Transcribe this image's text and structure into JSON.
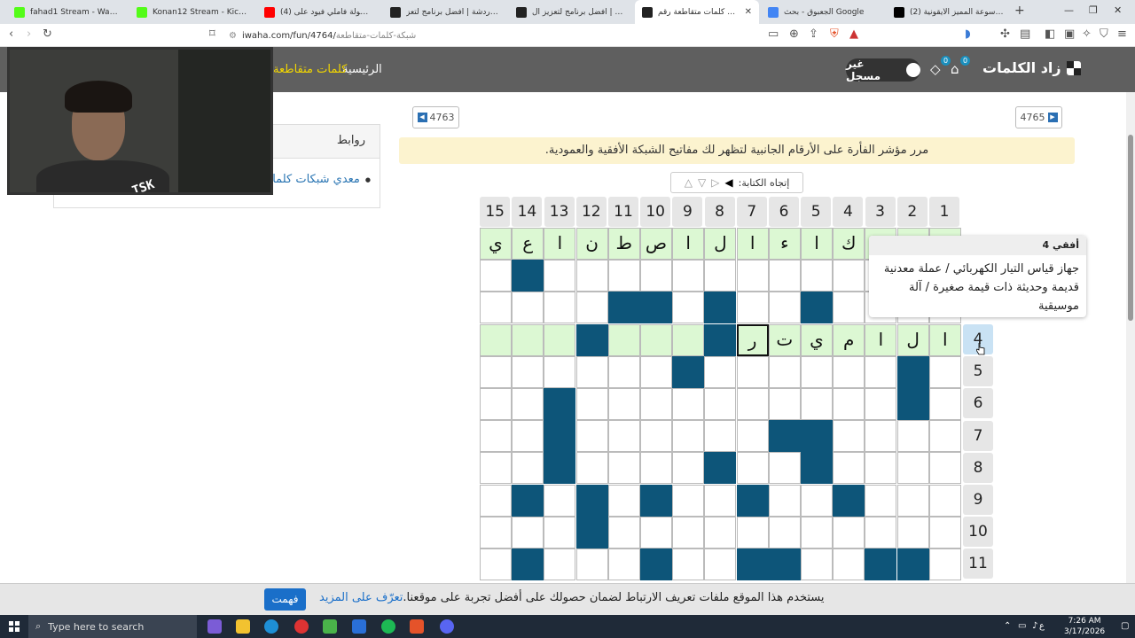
{
  "browser": {
    "tabs": [
      {
        "title": "fahad1 Stream - Watch Live on",
        "color": "#53fc18",
        "active": false
      },
      {
        "title": "Konan12 Stream - Kick Dashbo",
        "color": "#53fc18",
        "active": false
      },
      {
        "title": "(4) نهائي بطولة فاملي فيود على",
        "color": "#ff0000",
        "active": false
      },
      {
        "title": "بوت الدردشة | أفضل برنامج لتعز",
        "color": "#222222",
        "active": false
      },
      {
        "title": "التنبيهات | أفضل برنامج لتعزيز ال",
        "color": "#222222",
        "active": false
      },
      {
        "title": "شبكة كلمات متقاطعة رقم",
        "color": "#222222",
        "active": true
      },
      {
        "title": "الجعبوق - بحث Google",
        "color": "#4285f4",
        "active": false
      },
      {
        "title": "(2) موسوعة المميز الأيقونية +X",
        "color": "#000000",
        "active": false
      }
    ],
    "url_host": "iwaha.com/fun/4764/",
    "url_path": "شبكة-كلمات-متقاطعة"
  },
  "site": {
    "logo": "زاد الكلمات",
    "user_label": "غير مسجل",
    "badge_cart": "0",
    "badge_diamond": "0",
    "nav_home": "الرئيسية",
    "nav_crosswords": "كلمات متقاطعة"
  },
  "sidebar": {
    "heading": "روابط",
    "link": "معدي شبكات كلمات متقاطعة"
  },
  "main": {
    "prev_puzzle": "4763",
    "next_puzzle": "4765",
    "info": "مرر مؤشر الفأرة على الأرقام الجانبية لتظهر لك مفاتيح الشبكة الأفقية والعمودية.",
    "direction_label": "إتجاه الكتابة:"
  },
  "grid": {
    "col_numbers": [
      "1",
      "2",
      "3",
      "4",
      "5",
      "6",
      "7",
      "8",
      "9",
      "10",
      "11",
      "12",
      "13",
      "14",
      "15"
    ],
    "row_numbers": [
      "4",
      "5",
      "6",
      "7",
      "8",
      "9",
      "10",
      "11"
    ],
    "rows": [
      [
        "ي",
        "ع",
        "ا",
        "ن",
        "ط",
        "ص",
        "ا",
        "ل",
        "ا",
        "ء",
        "ا",
        "ك",
        "",
        "",
        ""
      ],
      [
        "",
        "#",
        "",
        "",
        "",
        "",
        "",
        "",
        "",
        "",
        "",
        "",
        "",
        "",
        ""
      ],
      [
        "",
        "",
        "",
        "",
        "#",
        "#",
        "",
        "#",
        "",
        "",
        "#",
        "",
        "",
        "",
        ""
      ],
      [
        "",
        "",
        "",
        "#",
        "",
        "",
        "",
        "#",
        "ر",
        "ت",
        "ي",
        "م",
        "ا",
        "ل",
        "ا"
      ],
      [
        "",
        "",
        "",
        "",
        "",
        "",
        "#",
        "",
        "",
        "",
        "",
        "",
        "",
        "#",
        ""
      ],
      [
        "",
        "",
        "#",
        "",
        "",
        "",
        "",
        "",
        "",
        "",
        "",
        "",
        "",
        "#",
        ""
      ],
      [
        "",
        "",
        "#",
        "",
        "",
        "",
        "",
        "",
        "",
        "#",
        "#",
        "",
        "",
        "",
        ""
      ],
      [
        "",
        "",
        "#",
        "",
        "",
        "",
        "",
        "#",
        "",
        "",
        "#",
        "",
        "",
        "",
        ""
      ],
      [
        "",
        "#",
        "",
        "#",
        "",
        "#",
        "",
        "",
        "#",
        "",
        "",
        "#",
        "",
        "",
        ""
      ],
      [
        "",
        "",
        "",
        "#",
        "",
        "",
        "",
        "",
        "",
        "",
        "",
        "",
        "",
        "",
        ""
      ],
      [
        "",
        "#",
        "",
        "",
        "",
        "#",
        "",
        "",
        "#",
        "#",
        "",
        "",
        "#",
        "#",
        ""
      ]
    ],
    "highlight_rows": [
      0,
      3
    ],
    "current_cell": {
      "row": 3,
      "col": 8
    }
  },
  "tooltip": {
    "title": "أفقي 4",
    "text": "جهاز قياس التيار الكهربائي / عملة معدنية قديمة وحديثة ذات قيمة صغيرة / آلة موسيقية"
  },
  "cookie": {
    "message": "يستخدم هذا الموقع ملفات تعريف الارتباط لضمان حصولك على أفضل تجربة على موقعنا.",
    "learn_more": "تعرّف على المزيد",
    "accept": "فهمت"
  },
  "webcam": {
    "overlay_text": "TSK"
  },
  "taskbar": {
    "search_placeholder": "Type here to search",
    "time": "7:26 AM",
    "date": "3/17/2026",
    "lang": "ع"
  },
  "colors": {
    "block": "#0d5579",
    "highlight": "#dcf8d3",
    "header": "#5f5f5f",
    "info": "#fcf3cf"
  }
}
